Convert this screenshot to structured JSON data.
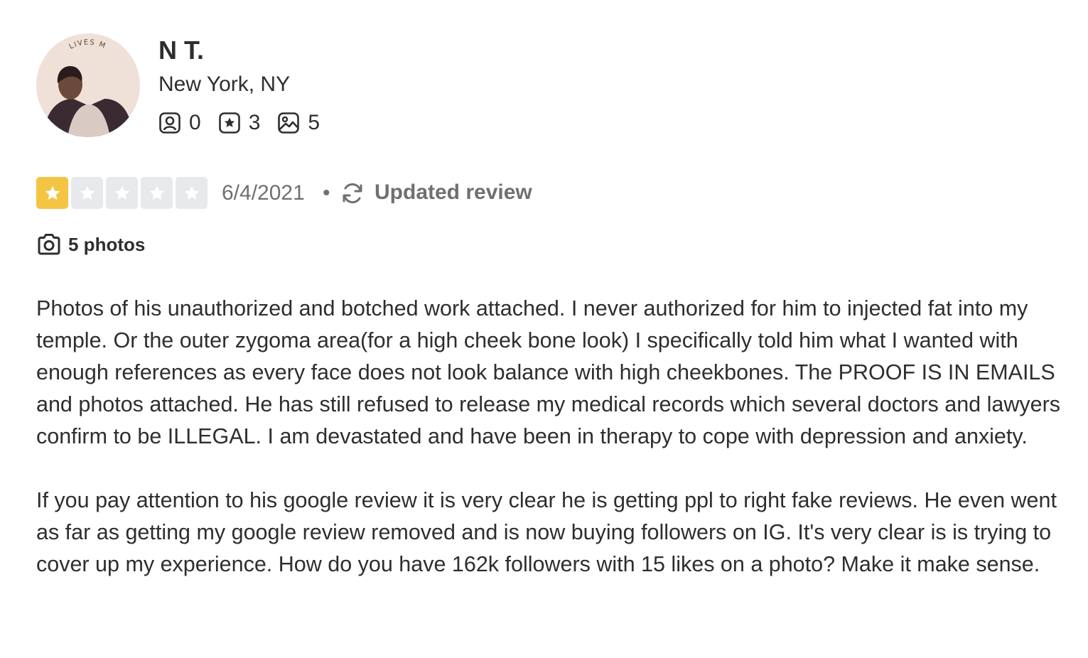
{
  "user": {
    "avatar_caption": "LIVES M",
    "name": "N T.",
    "location": "New York, NY",
    "stats": [
      {
        "icon": "friends-icon",
        "value": "0"
      },
      {
        "icon": "reviews-icon",
        "value": "3"
      },
      {
        "icon": "photos-icon",
        "value": "5"
      }
    ]
  },
  "review": {
    "rating": 1,
    "max_rating": 5,
    "star_color_on": "#f4c542",
    "star_color_off": "#e8e9ec",
    "date": "6/4/2021",
    "separator": "•",
    "updated_label": "Updated review",
    "photos_label": "5 photos",
    "paragraphs": [
      "Photos of his unauthorized and botched work attached. I never authorized for him to injected fat into my temple. Or the outer zygoma area(for a high cheek bone look) I specifically told him what I wanted with enough references as every face does not look balance with high cheekbones. The PROOF IS IN EMAILS and photos attached. He has still refused to release my medical records which several doctors and lawyers confirm to be ILLEGAL. I am devastated and have been in therapy to cope with depression and anxiety.",
      "If you pay attention to his google review it is very clear he is getting ppl to right fake reviews. He even went as far as getting my google review removed and is now buying followers on IG. It's very clear is is trying to cover up my experience. How do you have 162k followers with 15 likes on a photo? Make it make sense."
    ]
  }
}
